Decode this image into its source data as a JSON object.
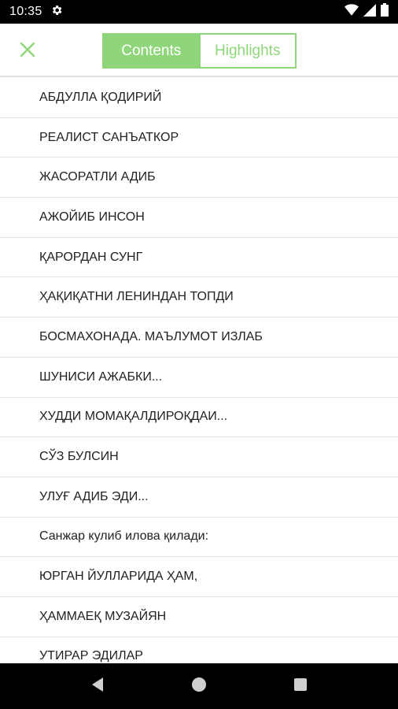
{
  "status_bar": {
    "time": "10:35",
    "icons": [
      "settings-gear-icon",
      "wifi-icon",
      "signal-icon",
      "battery-icon"
    ]
  },
  "header": {
    "close_icon": "close-icon",
    "tabs": [
      {
        "label": "Contents",
        "active": true
      },
      {
        "label": "Highlights",
        "active": false
      }
    ]
  },
  "toc": {
    "items": [
      "АБДУЛЛА ҚОДИРИЙ",
      "РЕАЛИСТ САНЪАТКОР",
      "ЖАСОРАТЛИ АДИБ",
      "АЖОЙИБ ИНСОН",
      "ҚАРОРДАН СУНГ",
      "ҲАҚИҚАТНИ ЛЕНИНДАН ТОПДИ",
      "БОСМАХОНАДА. МАЪЛУМОТ ИЗЛАБ",
      "ШУНИСИ АЖАБКИ...",
      "ХУДДИ МОМАҚАЛДИРОҚДАИ...",
      "СЎЗ БУЛСИН",
      "УЛУҒ АДИБ ЭДИ...",
      "Санжар кулиб илова қилади:",
      "ЮРГАН ЙУЛЛАРИДА ҲАМ,",
      "ҲАММАЕҚ МУЗАЙЯН",
      "УТИРАР ЭДИЛАР"
    ]
  },
  "nav_bar": {
    "icons": [
      "back-icon",
      "home-icon",
      "recents-icon"
    ]
  },
  "colors": {
    "accent": "#8fd67a",
    "text": "#222222",
    "divider": "#e4e4e4",
    "system_bar": "#000000"
  }
}
